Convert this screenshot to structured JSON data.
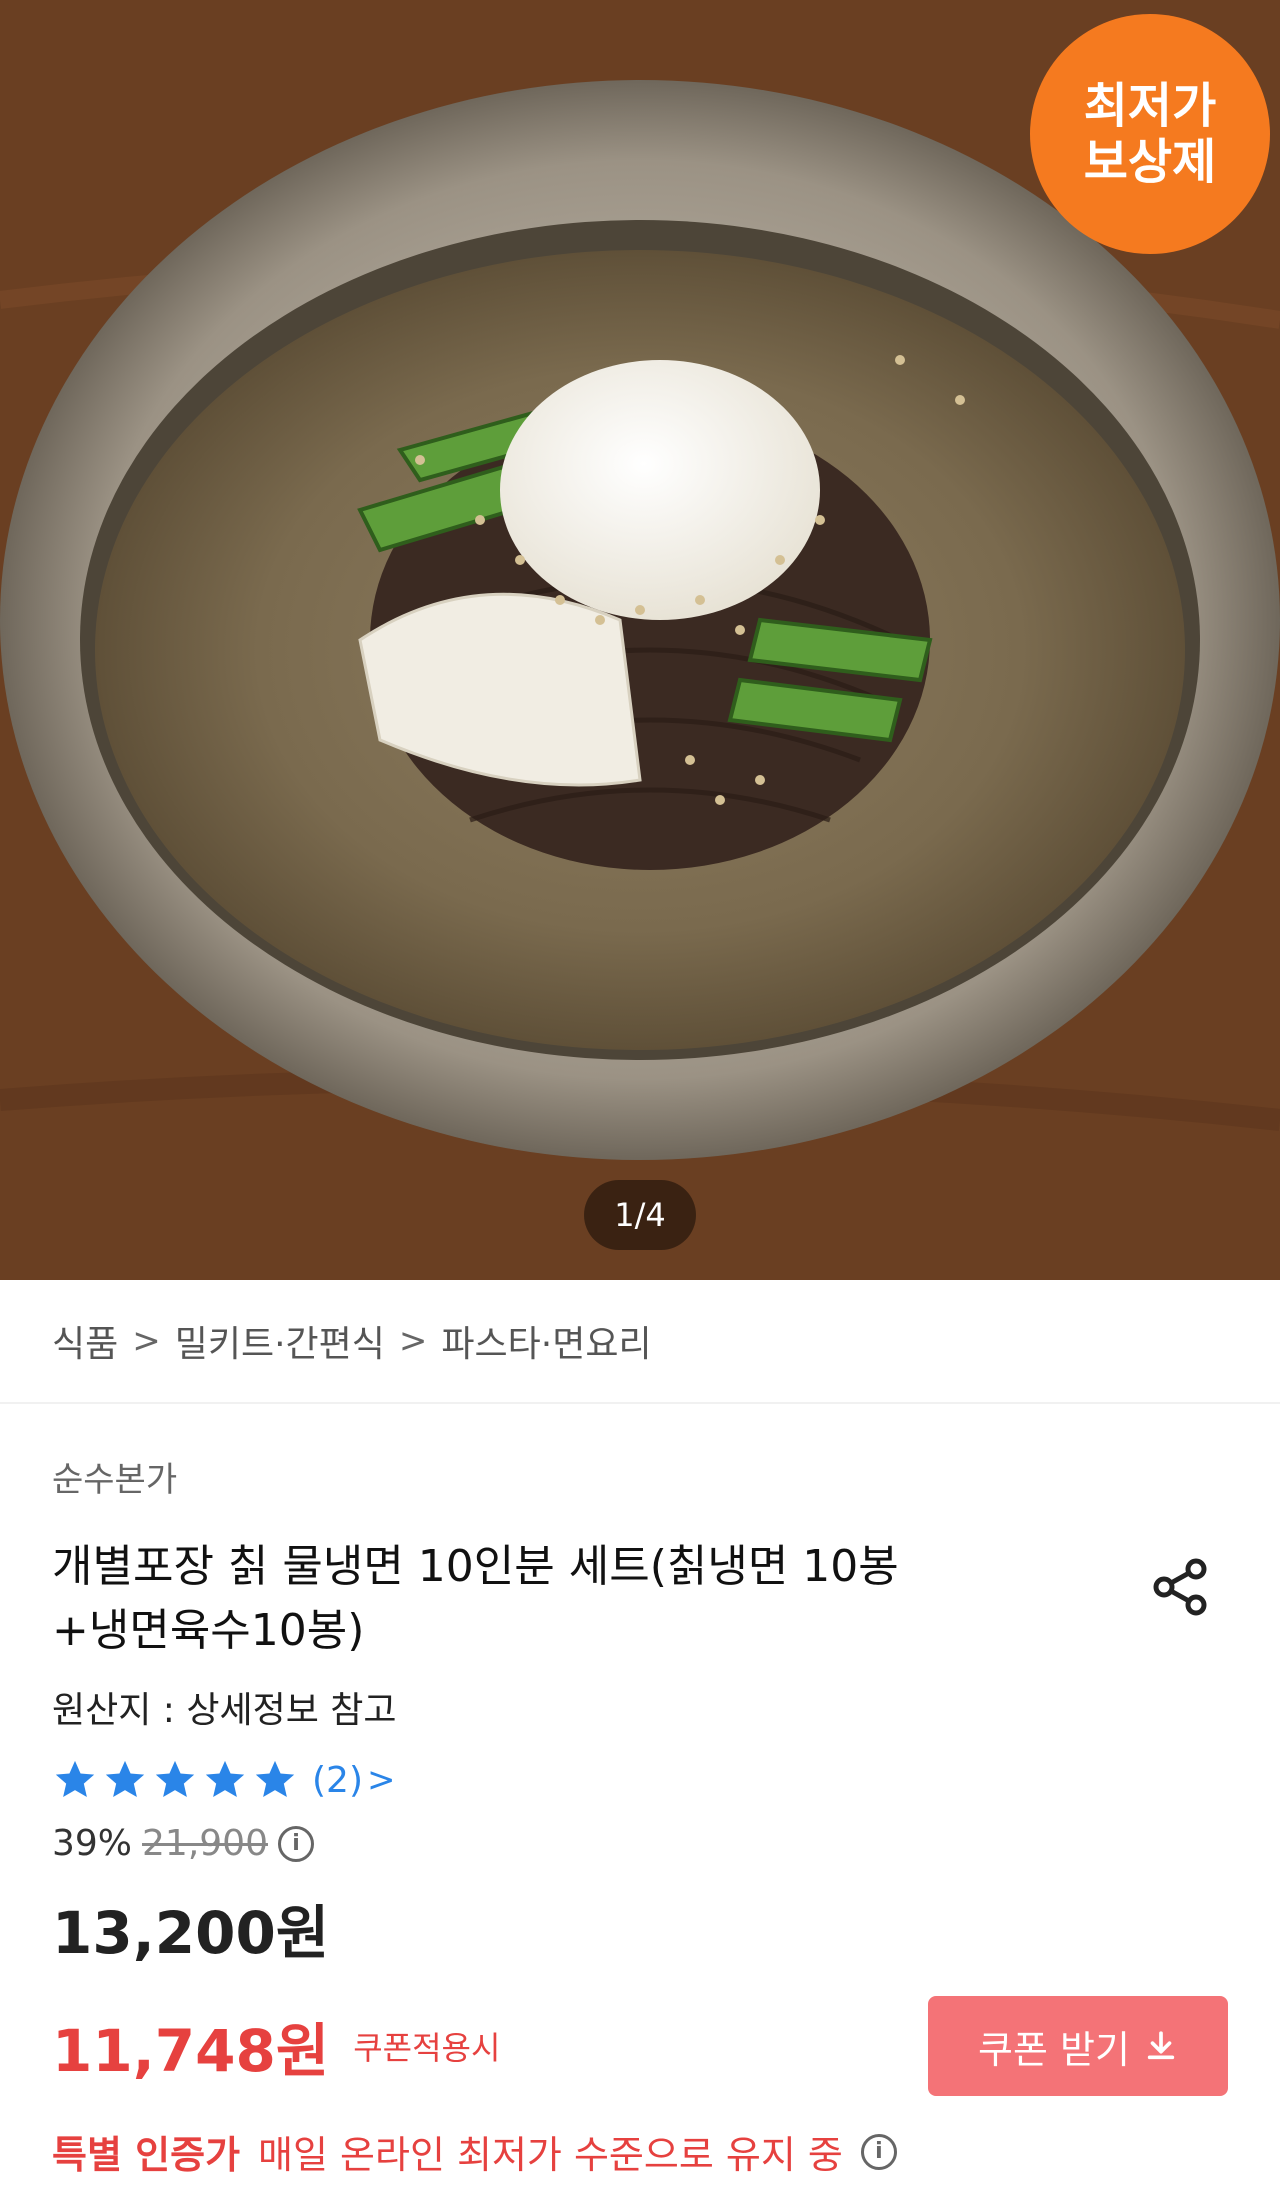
{
  "hero": {
    "badge_text": "최저가\n보상제",
    "pager": "1/4"
  },
  "breadcrumb": {
    "items": [
      "식품",
      "밀키트·간편식",
      "파스타·면요리"
    ],
    "separator": ">"
  },
  "product": {
    "brand": "순수본가",
    "title": "개별포장 칡 물냉면 10인분 세트(칡냉면 10봉+냉면육수10봉)",
    "origin": "원산지 : 상세정보 참고",
    "rating_stars": 5,
    "review_count": "(2)",
    "review_chevron": ">",
    "discount_rate": "39%",
    "original_price": "21,900",
    "price": "13,200원",
    "coupon_price": "11,748원",
    "coupon_note": "쿠폰적용시",
    "coupon_button": "쿠폰 받기",
    "special_label": "특별 인증가",
    "special_text": "매일 온라인 최저가 수준으로 유지 중"
  },
  "colors": {
    "badge": "#f57a1f",
    "accent_red": "#e6413f",
    "coupon_button": "#f47377",
    "star_blue": "#2a85e8"
  }
}
